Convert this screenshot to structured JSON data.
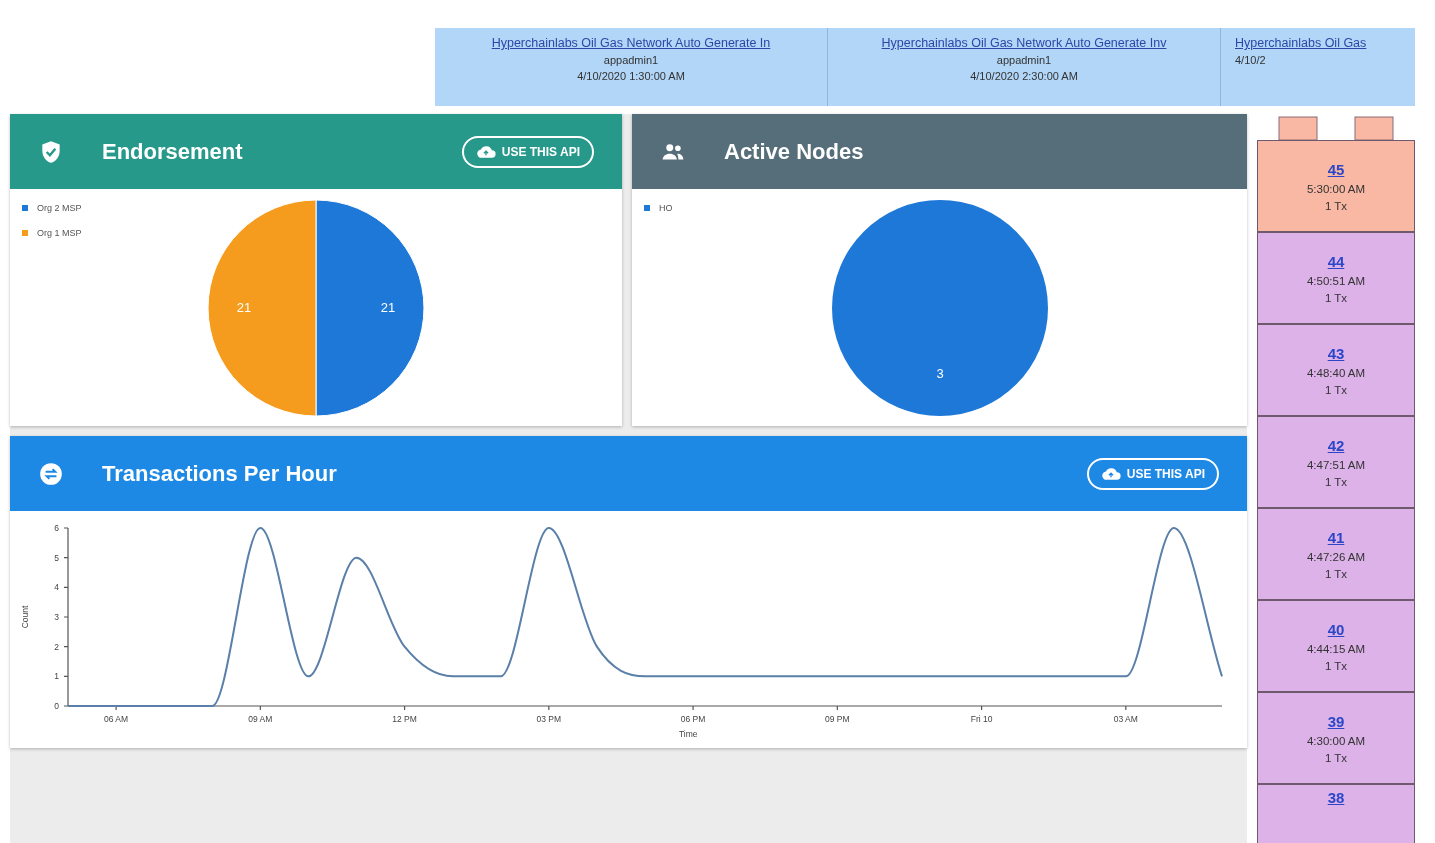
{
  "transaction_strip": [
    {
      "title": "Hyperchainlabs Oil Gas Network Auto Generate In",
      "creator": "appadmin1",
      "time": "4/10/2020 1:30:00 AM"
    },
    {
      "title": "Hyperchainlabs Oil Gas Network Auto Generate Inv",
      "creator": "appadmin1",
      "time": "4/10/2020 2:30:00 AM"
    },
    {
      "title": "Hyperchainlabs Oil Gas",
      "time": "4/10/2"
    }
  ],
  "endorsement": {
    "title": "Endorsement",
    "button": "USE THIS API",
    "chart_data": {
      "type": "pie",
      "data_labels": true,
      "legend": "top-left",
      "categories": [
        "Org 2 MSP",
        "Org 1 MSP"
      ],
      "values": [
        21,
        21
      ]
    },
    "slices": [
      {
        "color": "#1e78d7"
      },
      {
        "color": "#f59c1f"
      }
    ]
  },
  "active_nodes": {
    "title": "Active Nodes",
    "chart_data": {
      "type": "pie",
      "data_labels": true,
      "legend": "top-left",
      "categories": [
        "HO"
      ],
      "values": [
        3
      ]
    },
    "slices": [
      {
        "color": "#1e78d7"
      }
    ]
  },
  "transactions_per_hour": {
    "title": "Transactions Per Hour",
    "button": "USE THIS API",
    "chart_data": {
      "type": "line",
      "xlabel": "Time",
      "ylabel": "Count",
      "categories": [
        null,
        "06 AM",
        null,
        null,
        "09 AM",
        null,
        null,
        "12 PM",
        null,
        null,
        "03 PM",
        null,
        null,
        "06 PM",
        null,
        null,
        "09 PM",
        null,
        null,
        "Fri 10",
        null,
        null,
        "03 AM",
        null,
        null
      ],
      "ylim": [
        0,
        6
      ],
      "yticks": [
        0,
        1,
        2,
        3,
        4,
        5,
        6
      ],
      "series": [
        {
          "color": "#5a7fa8",
          "values": [
            0,
            0,
            0,
            0,
            6,
            1,
            5,
            2,
            1,
            1,
            6,
            2,
            1,
            1,
            1,
            1,
            1,
            1,
            1,
            1,
            1,
            1,
            1,
            6,
            1
          ]
        }
      ]
    }
  },
  "blocks": [
    {
      "number": "45",
      "time": "5:30:00 AM",
      "tx": "1 Tx",
      "color": "#f8b8a3"
    },
    {
      "number": "44",
      "time": "4:50:51 AM",
      "tx": "1 Tx",
      "color": "#dcb2e8"
    },
    {
      "number": "43",
      "time": "4:48:40 AM",
      "tx": "1 Tx",
      "color": "#dcb2e8"
    },
    {
      "number": "42",
      "time": "4:47:51 AM",
      "tx": "1 Tx",
      "color": "#dcb2e8"
    },
    {
      "number": "41",
      "time": "4:47:26 AM",
      "tx": "1 Tx",
      "color": "#dcb2e8"
    },
    {
      "number": "40",
      "time": "4:44:15 AM",
      "tx": "1 Tx",
      "color": "#dcb2e8"
    },
    {
      "number": "39",
      "time": "4:30:00 AM",
      "tx": "1 Tx",
      "color": "#dcb2e8"
    },
    {
      "number": "38",
      "color": "#dcb2e8"
    }
  ]
}
